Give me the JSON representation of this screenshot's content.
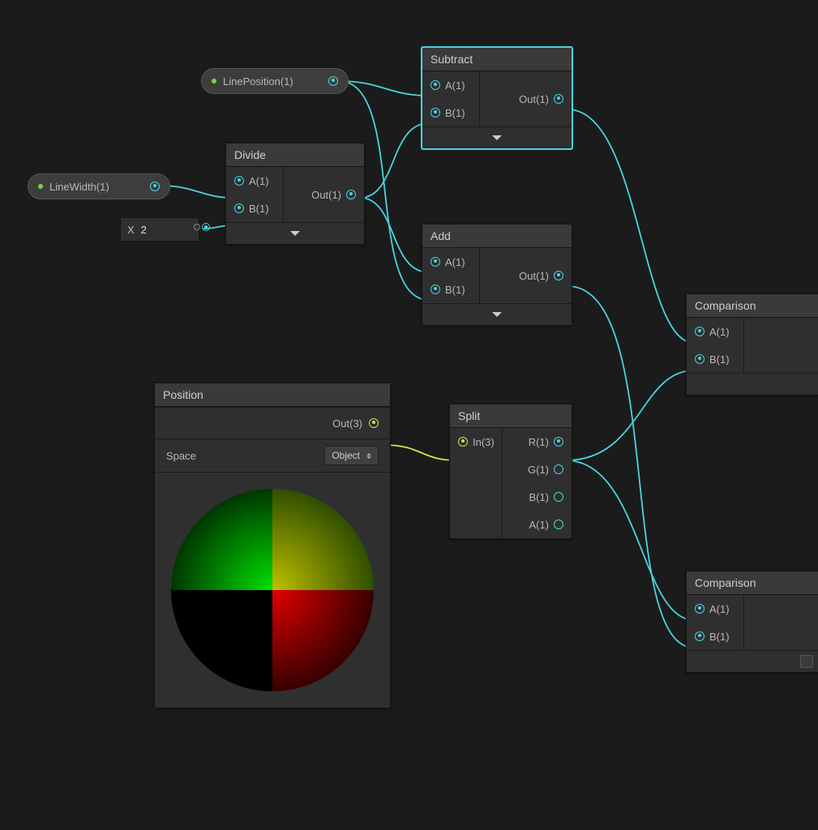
{
  "properties": {
    "linePosition": {
      "label": "LinePosition(1)"
    },
    "lineWidth": {
      "label": "LineWidth(1)"
    },
    "xValue": {
      "prefix": "X",
      "value": "2"
    }
  },
  "nodes": {
    "subtract": {
      "title": "Subtract",
      "a": "A(1)",
      "b": "B(1)",
      "out": "Out(1)"
    },
    "divide": {
      "title": "Divide",
      "a": "A(1)",
      "b": "B(1)",
      "out": "Out(1)"
    },
    "add": {
      "title": "Add",
      "a": "A(1)",
      "b": "B(1)",
      "out": "Out(1)"
    },
    "split": {
      "title": "Split",
      "in": "In(3)",
      "r": "R(1)",
      "g": "G(1)",
      "b": "B(1)",
      "a": "A(1)"
    },
    "position": {
      "title": "Position",
      "out": "Out(3)",
      "spaceLabel": "Space",
      "spaceValue": "Object"
    },
    "comparison1": {
      "title": "Comparison",
      "a": "A(1)",
      "b": "B(1)"
    },
    "comparison2": {
      "title": "Comparison",
      "a": "A(1)",
      "b": "B(1)"
    }
  }
}
